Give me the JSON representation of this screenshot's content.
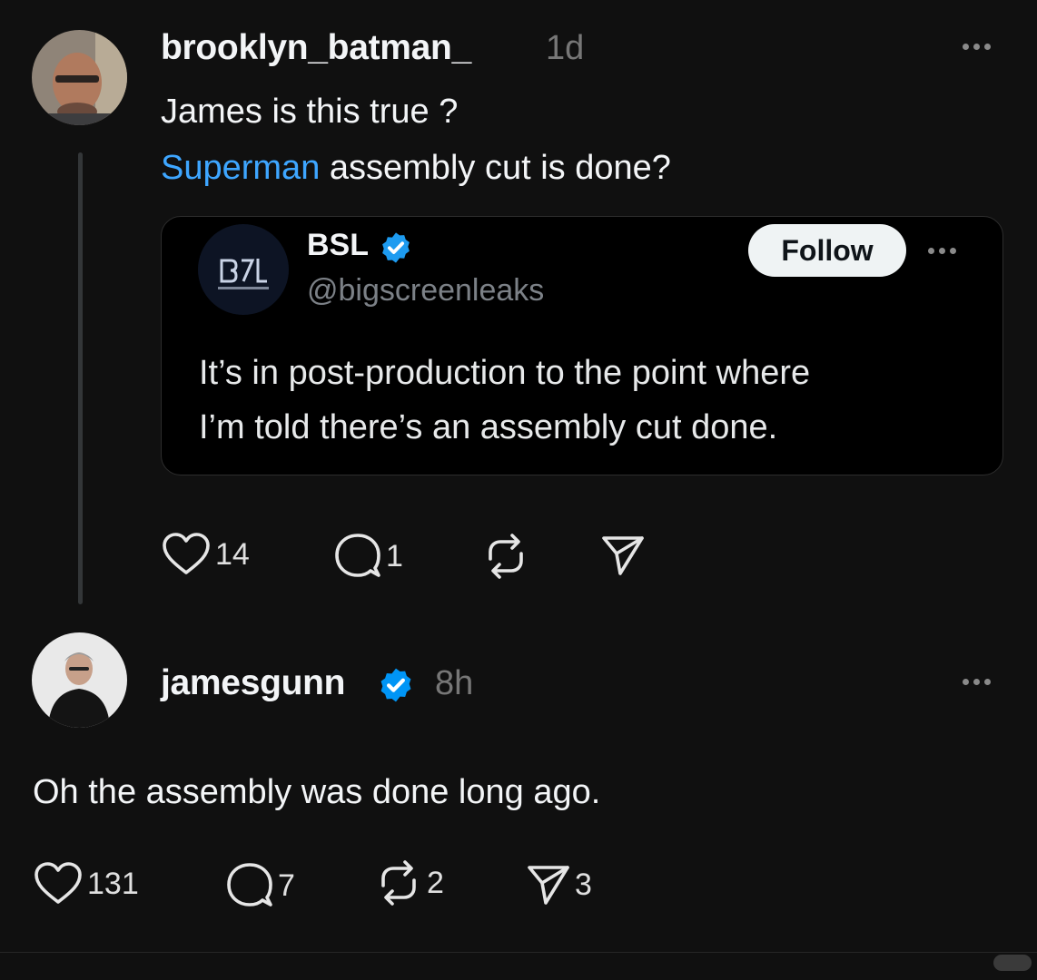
{
  "post": {
    "username": "brooklyn_batman_",
    "timestamp": "1d",
    "text_line1": "James is this true ?",
    "mention": "Superman",
    "text_line2_rest": " assembly cut is done?",
    "quoted": {
      "name": "BSL",
      "handle": "@bigscreenleaks",
      "follow_label": "Follow",
      "text_line1": "It’s in post-production to the point where",
      "text_line2": "I’m told there’s an assembly cut done."
    },
    "actions": {
      "likes": "14",
      "replies": "1"
    }
  },
  "reply": {
    "username": "jamesgunn",
    "verified": true,
    "timestamp": "8h",
    "text": "Oh the assembly was done long ago.",
    "actions": {
      "likes": "131",
      "replies": "7",
      "reposts": "2",
      "shares": "3"
    }
  },
  "icons": {
    "like": "heart-icon",
    "reply": "speech-bubble-icon",
    "repost": "repost-icon",
    "share": "paper-plane-icon",
    "verified": "verified-badge-icon",
    "more": "more-options-icon"
  },
  "colors": {
    "background": "#101010",
    "mention": "#3ea6ff",
    "verified": "#0095f6"
  }
}
